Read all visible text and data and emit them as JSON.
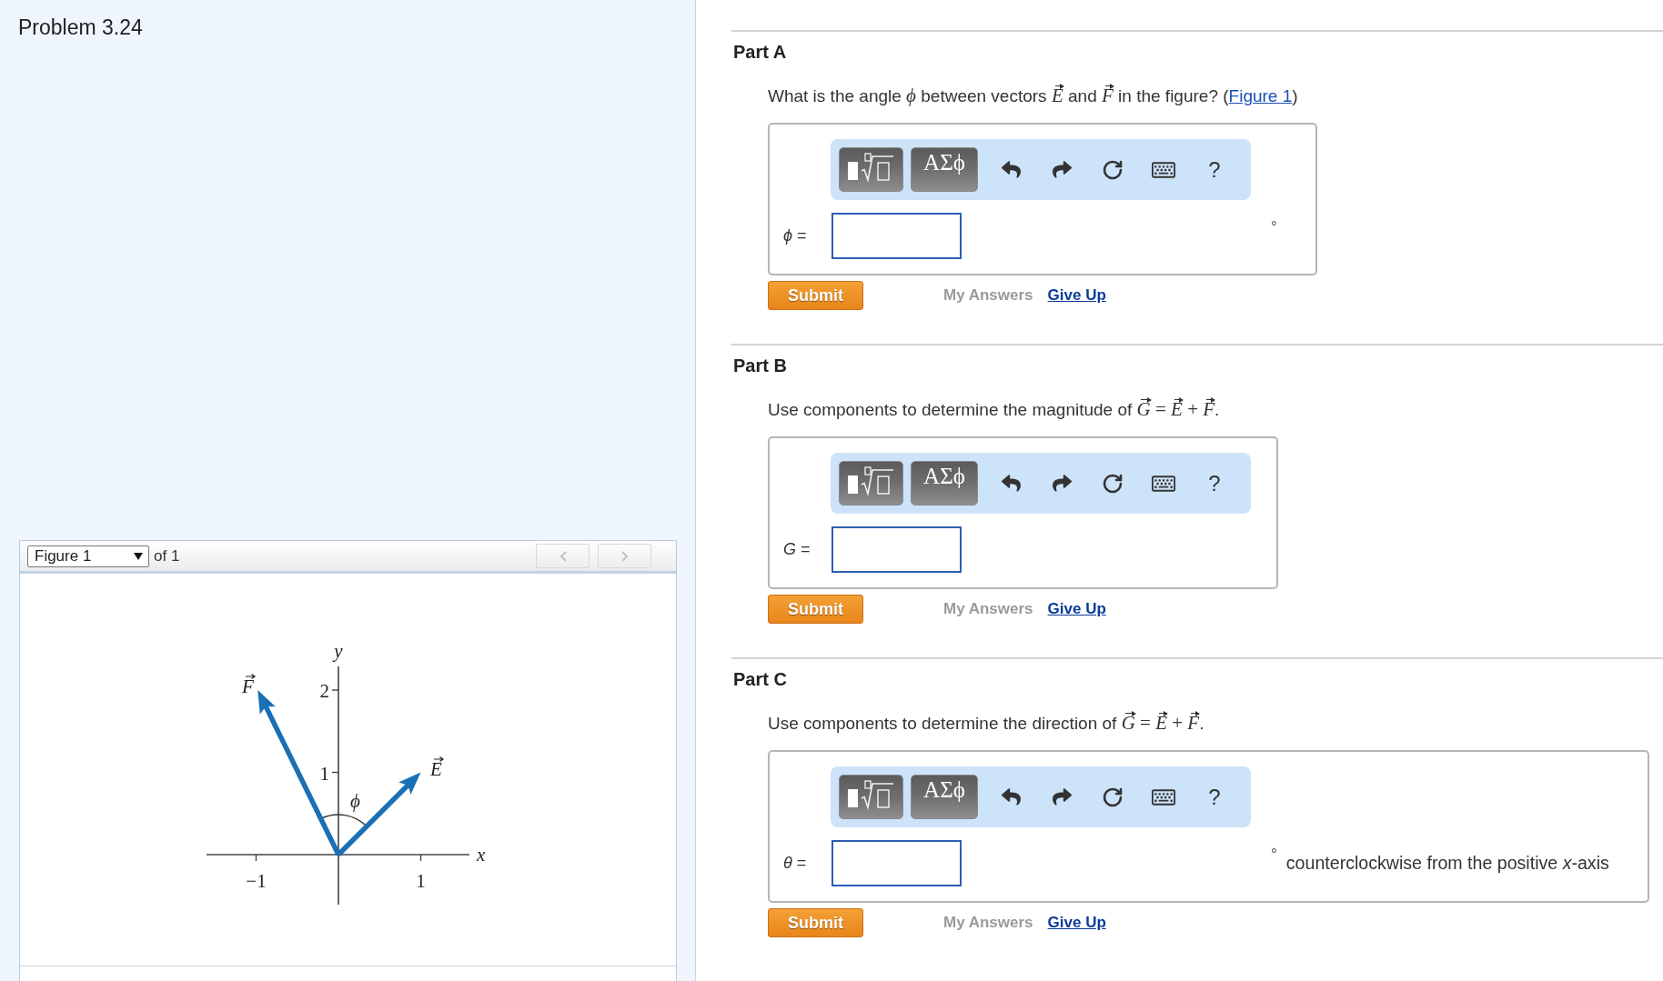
{
  "problem_title": "Problem 3.24",
  "figure_viewer": {
    "select": {
      "label": "Figure 1"
    },
    "count": "of 1",
    "previous": {
      "disabled": true
    },
    "next": {
      "disabled": true
    },
    "diagram": {
      "axis_labels": [
        "x",
        "y"
      ],
      "x_tick_labels": [
        "−1",
        "1"
      ],
      "y_tick_labels": [
        "2",
        "1"
      ],
      "vectors": [
        {
          "label": "F",
          "arrow": true
        },
        {
          "label": "E",
          "arrow": true
        }
      ],
      "angle_label": "ϕ"
    }
  },
  "parts": [
    {
      "title": "Part A",
      "prompt": [
        {
          "kind": "text",
          "text": "What is the angle "
        },
        {
          "kind": "math",
          "text": "ϕ",
          "arrow": false
        },
        {
          "kind": "text",
          "text": " between vectors "
        },
        {
          "kind": "math",
          "text": "E",
          "arrow": true
        },
        {
          "kind": "text",
          "text": " and "
        },
        {
          "kind": "math",
          "text": "F",
          "arrow": true
        },
        {
          "kind": "text",
          "text": " in the figure? ("
        },
        {
          "kind": "link",
          "text": "Figure 1"
        },
        {
          "kind": "text",
          "text": ")"
        }
      ],
      "toolbar": {
        "greek_button": "ΑΣϕ",
        "help_button": "?"
      },
      "answer": {
        "label": "*ϕ* =",
        "unit": "°"
      },
      "submit": "Submit",
      "my_answers": {
        "label": "My Answers",
        "disabled": true
      },
      "give_up": "Give Up"
    },
    {
      "title": "Part B",
      "prompt": [
        {
          "kind": "text",
          "text": "Use components to determine the magnitude of "
        },
        {
          "kind": "math",
          "text": "G",
          "arrow": true
        },
        {
          "kind": "operator",
          "text": " = "
        },
        {
          "kind": "math",
          "text": "E",
          "arrow": true
        },
        {
          "kind": "operator",
          "text": " + "
        },
        {
          "kind": "math",
          "text": "F",
          "arrow": true
        },
        {
          "kind": "text",
          "text": "."
        }
      ],
      "toolbar": {
        "greek_button": "ΑΣϕ",
        "help_button": "?"
      },
      "answer": {
        "label": "*G* ="
      },
      "submit": "Submit",
      "my_answers": {
        "label": "My Answers",
        "disabled": true
      },
      "give_up": "Give Up"
    },
    {
      "title": "Part C",
      "prompt": [
        {
          "kind": "text",
          "text": "Use components to determine the direction of "
        },
        {
          "kind": "math",
          "text": "G",
          "arrow": true
        },
        {
          "kind": "operator",
          "text": " = "
        },
        {
          "kind": "math",
          "text": "E",
          "arrow": true
        },
        {
          "kind": "operator",
          "text": " + "
        },
        {
          "kind": "math",
          "text": "F",
          "arrow": true
        },
        {
          "kind": "text",
          "text": "."
        }
      ],
      "toolbar": {
        "greek_button": "ΑΣϕ",
        "help_button": "?"
      },
      "answer": {
        "label": "*θ* =",
        "unit": "°",
        "unit_note": "counterclockwise from the positive *x*-axis"
      },
      "submit": "Submit",
      "my_answers": {
        "label": "My Answers",
        "disabled": true
      },
      "give_up": "Give Up"
    }
  ]
}
